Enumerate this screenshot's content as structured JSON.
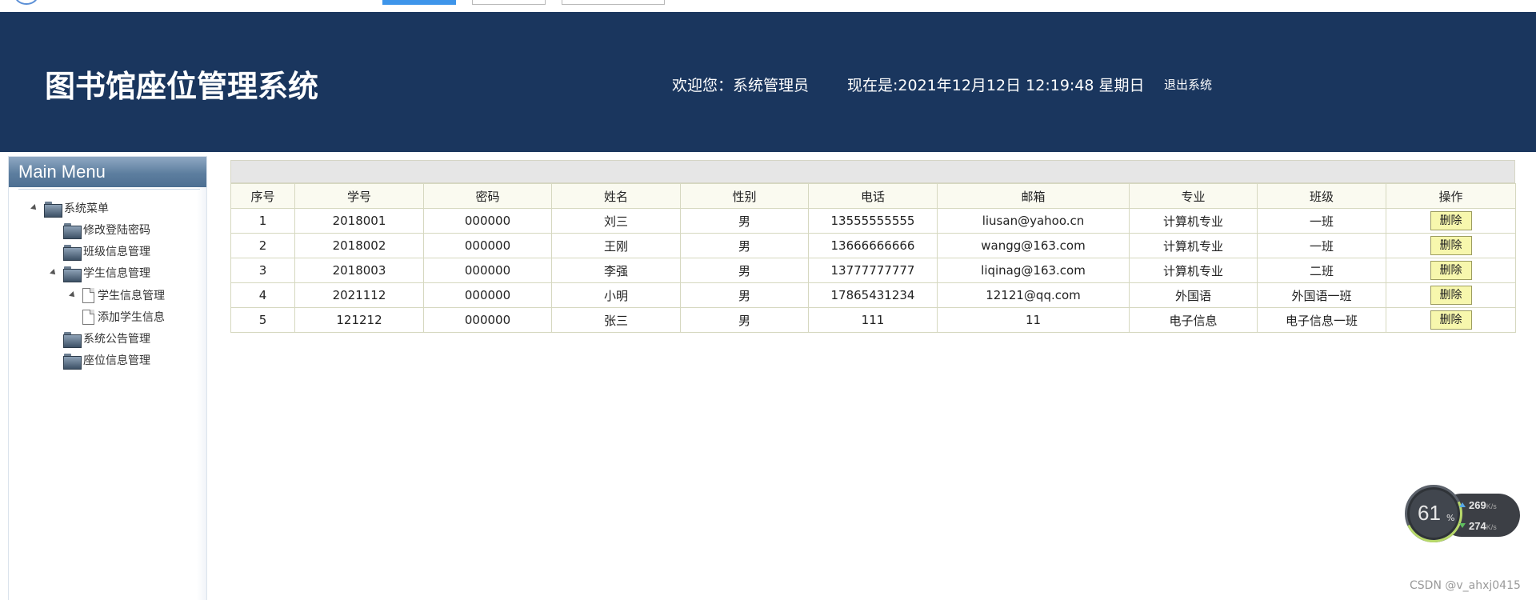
{
  "header": {
    "title": "图书馆座位管理系统",
    "welcome": "欢迎您：系统管理员",
    "now": "现在是:2021年12月12日 12:19:48 星期日",
    "logout": "退出系统"
  },
  "sidebar": {
    "heading": "Main Menu",
    "tree": {
      "root": "系统菜单",
      "items": [
        {
          "label": "修改登陆密码"
        },
        {
          "label": "班级信息管理"
        },
        {
          "label": "学生信息管理",
          "children": [
            {
              "label": "学生信息管理"
            },
            {
              "label": "添加学生信息"
            }
          ]
        },
        {
          "label": "系统公告管理"
        },
        {
          "label": "座位信息管理"
        }
      ]
    }
  },
  "table": {
    "columns": [
      "序号",
      "学号",
      "密码",
      "姓名",
      "性别",
      "电话",
      "邮箱",
      "专业",
      "班级",
      "操作"
    ],
    "rows": [
      [
        "1",
        "2018001",
        "000000",
        "刘三",
        "男",
        "13555555555",
        "liusan@yahoo.cn",
        "计算机专业",
        "一班"
      ],
      [
        "2",
        "2018002",
        "000000",
        "王刚",
        "男",
        "13666666666",
        "wangg@163.com",
        "计算机专业",
        "一班"
      ],
      [
        "3",
        "2018003",
        "000000",
        "李强",
        "男",
        "13777777777",
        "liqinag@163.com",
        "计算机专业",
        "二班"
      ],
      [
        "4",
        "2021112",
        "000000",
        "小明",
        "男",
        "17865431234",
        "12121@qq.com",
        "外国语",
        "外国语一班"
      ],
      [
        "5",
        "121212",
        "000000",
        "张三",
        "男",
        "111",
        "11",
        "电子信息",
        "电子信息一班"
      ]
    ],
    "delete_label": "删除"
  },
  "net_widget": {
    "percent": "61",
    "percent_sign": "%",
    "upload": "269",
    "download": "274",
    "unit": "K/s"
  },
  "watermark": "CSDN @v_ahxj0415",
  "colors": {
    "header_bg": "#1a365e",
    "delete_button_bg": "#f7f7ad",
    "table_border": "#d6d8c0"
  }
}
